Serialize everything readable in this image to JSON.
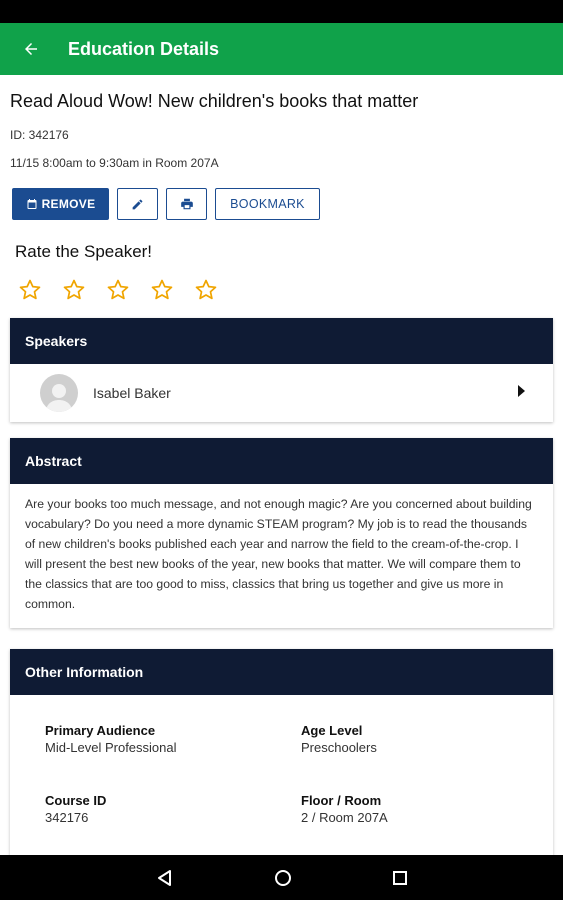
{
  "app_bar": {
    "title": "Education Details"
  },
  "event": {
    "title": "Read Aloud Wow! New children's books that matter",
    "id_text": "ID: 342176",
    "time_text": "11/15 8:00am to 9:30am in Room 207A"
  },
  "actions": {
    "remove_label": "REMOVE",
    "bookmark_label": "BOOKMARK"
  },
  "rating": {
    "title": "Rate the Speaker!",
    "max": 5,
    "value": 0,
    "star_color": "#f0a500"
  },
  "speakers": {
    "header": "Speakers",
    "items": [
      {
        "name": "Isabel Baker"
      }
    ]
  },
  "abstract": {
    "header": "Abstract",
    "text": "Are your books too much message, and not enough magic? Are you concerned about building vocabulary? Do you need a more dynamic STEAM program? My job is to read the thousands of new children's books published each year and narrow the field to the cream-of-the-crop. I will present the best new books of the year, new books that matter. We will compare them to the classics that are too good to miss, classics that bring us together and give us more in common."
  },
  "other_info": {
    "header": "Other Information",
    "fields": [
      {
        "label": "Primary Audience",
        "value": "Mid-Level Professional"
      },
      {
        "label": "Age Level",
        "value": "Preschoolers"
      },
      {
        "label": "Course ID",
        "value": "342176"
      },
      {
        "label": "Floor / Room",
        "value": "2 / Room 207A"
      }
    ]
  },
  "colors": {
    "brand_green": "#10a24a",
    "primary_blue": "#1b4c91",
    "header_navy": "#0f1b34"
  }
}
